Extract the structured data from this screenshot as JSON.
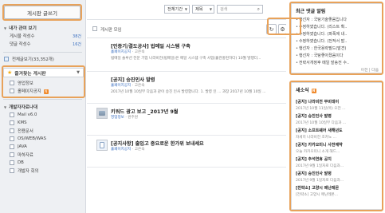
{
  "sidebar": {
    "write_button": "게시판 글쓰기",
    "my_posts": {
      "title": "내가 관여 보기",
      "items": [
        {
          "label": "게시물 작성수",
          "count": "38건"
        },
        {
          "label": "댓글 작성수",
          "count": "16건"
        }
      ]
    },
    "all_posts": {
      "label": "전체글보기(33,352개)"
    },
    "favorites": {
      "title": "즐겨찾는 게시판",
      "items": [
        {
          "label": "영업정보"
        },
        {
          "label": "홀페이지공지",
          "badge": "N"
        }
      ]
    },
    "dev_data": {
      "title": "개발자자료나대",
      "items": [
        {
          "label": "Mail v6.0"
        },
        {
          "label": "KMS"
        },
        {
          "label": "전용문서"
        },
        {
          "label": "OS/WEB/WAS"
        },
        {
          "label": "JAVA"
        },
        {
          "label": "마하자료"
        },
        {
          "label": "DB"
        },
        {
          "label": "개발자 회의"
        }
      ]
    }
  },
  "topbar": {
    "period_select": "전체기간",
    "field_select": "제목",
    "search_placeholder": "검색"
  },
  "list": {
    "header": "게시판 모임",
    "posts": [
      {
        "title": "[인증기/결도공사] 법메일 시스템 구축",
        "author": "홀페이지공지",
        "meta_rest": "고은숙",
        "excerpt": "법메일 솔루션 전문 기업 나라비전(법메일)은 메일 시스템 구축 사업(홀관홍련하다) 10월 발행더..."
      },
      {
        "title": "[공지] 승진인사 발령",
        "author": "홀페이지공지",
        "meta_rest": "고은숙",
        "excerpt": "2017년 10월 10일부 다음과 같이 승진 인사 발령합니다. 1. 발령 인 ... 과장 2017년 10월 10일 ..."
      },
      {
        "title": "키워드 광고 보고 _2017년 9월",
        "author": "영업정보",
        "meta_rest": "원주원",
        "excerpt": ""
      },
      {
        "title": "[공지사항] 출입고 중요로운 한가위 보내세요",
        "author": "홀페이지공지",
        "meta_rest": "고은숙",
        "excerpt": ""
      }
    ]
  },
  "comments_panel": {
    "title": "최근 댓글 알림",
    "items": [
      "행선자 : 국탕기술좋음입니다",
      "수정하였습니다. (리스트 확..",
      "수정하였습니다. (파폭에 내..",
      "수정하였습니다. (전적서 발..",
      "행선자 : 한국용략필드(발견)",
      "행선자 : 국탕좋아졌음이다",
      "전략서개정후 메일 발송전 수.."
    ],
    "footer_prev": "이전",
    "footer_next": "다음"
  },
  "news_panel": {
    "title": "새소식",
    "items": [
      {
        "title": "[공지] 나라비전 무비데이",
        "sub": "2017년 10월 11일(목) 오전 ..."
      },
      {
        "title": "[공지] 승진인사 발령",
        "sub": "2017년 10월 10일부 다음과 ..."
      },
      {
        "title": "[공지] 소프트웨어 새해년도",
        "sub": "자세히 나라비전 조카노 ..."
      },
      {
        "title": "[공지] 카카오미니 사전예약",
        "sub": "오늘 카카오미니 소개 해드..."
      },
      {
        "title": "[공지] 추석연휴 공지",
        "sub": "2017년 9월 1일자로 다음과..."
      },
      {
        "title": "[공지] 승진인사 발령",
        "sub": "2017년 9월 1일자로 다음과..."
      },
      {
        "title": "[전략소] 고양시 메난레몬",
        "sub": "[전략소] 고양시 메난레몬..."
      }
    ]
  },
  "colors": {
    "highlight": "#e8a25a",
    "link": "#3b6fc0",
    "star": "#f2b01e"
  }
}
